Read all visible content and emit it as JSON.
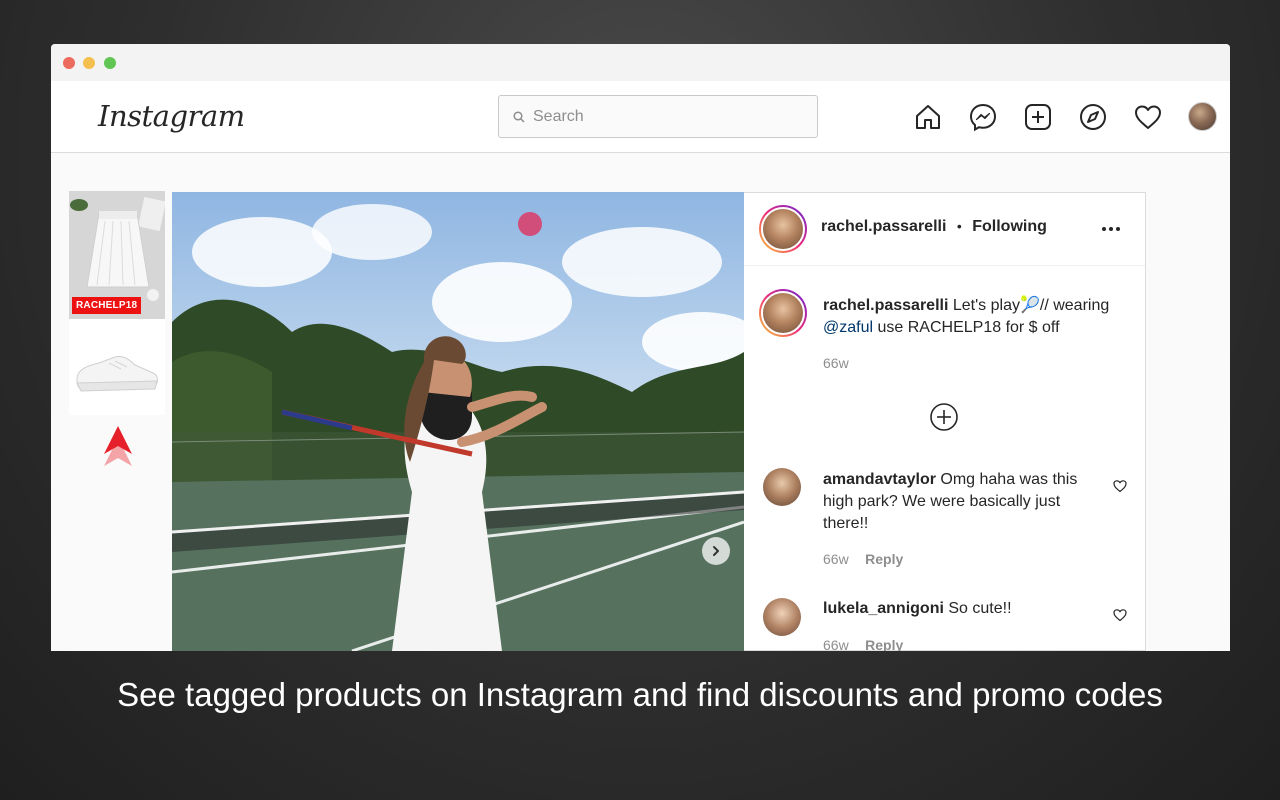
{
  "header": {
    "logo": "Instagram",
    "search_placeholder": "Search"
  },
  "sidebar": {
    "promo_code": "RACHELP18"
  },
  "post": {
    "author": "rachel.passarelli",
    "follow_status": "Following",
    "separator": "•",
    "caption_author": "rachel.passarelli",
    "caption_text_1": "Let's play",
    "caption_emoji": "🎾",
    "caption_text_2": "// wearing",
    "caption_mention": "@zaful",
    "caption_text_3": "use RACHELP18 for $ off",
    "caption_age": "66w"
  },
  "comments": [
    {
      "user": "amandavtaylor",
      "text": "Omg haha was this high park? We were basically just there!!",
      "age": "66w",
      "reply": "Reply"
    },
    {
      "user": "lukela_annigoni",
      "text": "So cute!!",
      "age": "66w",
      "reply": "Reply"
    }
  ],
  "footer": {
    "caption": "See tagged products on Instagram and find discounts and promo codes"
  },
  "colors": {
    "promo_badge": "#ee1111",
    "arrow": "#e5202b",
    "mention": "#00376b"
  },
  "icons": [
    "search-icon",
    "home-icon",
    "messenger-icon",
    "new-post-icon",
    "explore-icon",
    "heart-icon",
    "more-options-icon",
    "add-comment-icon",
    "chevron-right-icon",
    "arrow-up-icon"
  ]
}
